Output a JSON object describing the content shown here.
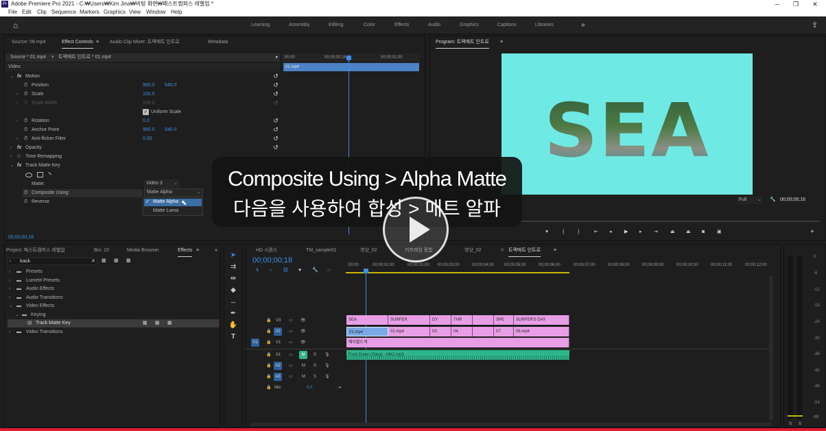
{
  "app": {
    "icon": "Pr",
    "title": "Adobe Premiere Pro 2021 - C:₩Users₩Kim Jina₩바탕 화면₩패스트캠퍼스 레벨업 *"
  },
  "menu": [
    "File",
    "Edit",
    "Clip",
    "Sequence",
    "Markers",
    "Graphics",
    "View",
    "Window",
    "Help"
  ],
  "workspaces": [
    "Learning",
    "Assembly",
    "Editing",
    "Color",
    "Effects",
    "Audio",
    "Graphics",
    "Captions",
    "Libraries"
  ],
  "source_tabs": {
    "source": "Source: 08.mp4",
    "effect_controls": "Effect Controls",
    "mixer": "Audio Clip Mixer: 트랙매트 인트로",
    "metadata": "Metadata"
  },
  "ec": {
    "source": "Source * 01.mp4",
    "seq": "트랙매트 인트로 * 01.mp4",
    "video": "Video",
    "motion": "Motion",
    "position": "Position",
    "position_x": "960.0",
    "position_y": "540.0",
    "scale": "Scale",
    "scale_val": "100.0",
    "scale_width": "Scale Width",
    "scale_width_val": "100.0",
    "uniform": "Uniform Scale",
    "rotation": "Rotation",
    "rotation_val": "0.0",
    "anchor": "Anchor Point",
    "anchor_x": "960.0",
    "anchor_y": "540.0",
    "antiflicker": "Anti-flicker Filter",
    "antiflicker_val": "0.00",
    "opacity": "Opacity",
    "time_remap": "Time Remapping",
    "track_matte": "Track Matte Key",
    "matte": "Matte:",
    "matte_val": "Video 3",
    "composite": "Composite Using:",
    "composite_val": "Matte Alpha",
    "reverse": "Reverse",
    "opt1": "Matte Alpha",
    "opt2": "Matte Luma",
    "timecode": "00;00;00;18",
    "ruler": [
      ";00;00",
      "00;00;00;16",
      "00;00;01;00"
    ],
    "clip": "01.mp4"
  },
  "program": {
    "title": "Program: 트랙매트 인트로",
    "word": "SEA",
    "fit": "Full",
    "timecode": "00;00;06;16"
  },
  "project": {
    "tabs": [
      "Project: 패스트캠퍼스 레벨업",
      "Bin: 10",
      "Media Browser",
      "Effects"
    ],
    "search": "track",
    "items": [
      "Presets",
      "Lumetri Presets",
      "Audio Effects",
      "Audio Transitions",
      "Video Effects",
      "Keying",
      "Track Matte Key",
      "Video Transitions"
    ]
  },
  "timeline": {
    "tabs": [
      "HD 시퀀스",
      "TM_sample01",
      "영상_02",
      "키프레임 종합",
      "영상_02",
      "트랙매트 인트로"
    ],
    "timecode": "00;00;00;18",
    "ruler": [
      ";00;00",
      "00;00;01;00",
      "00;00;02;00",
      "00;00;03;00",
      "00;00;04;00",
      "00;00;05;00",
      "00;00;06;00",
      "00;00;07;00",
      "00;00;08;00",
      "00;00;09;00",
      "00;00;10;00",
      "00;00;11;00",
      "00;00;12;00"
    ],
    "tracks": [
      "V3",
      "V2",
      "V1",
      "A1",
      "A2",
      "A3"
    ],
    "source_patch": [
      "V1",
      "A1"
    ],
    "mix": "Mix",
    "mix_val": "0.0",
    "v3": [
      "SEA",
      "SURFER",
      "DY",
      "THR",
      "",
      "SPE",
      "SURFER'S DAY"
    ],
    "v2": [
      "01.mp4",
      "02.mp4",
      "03.",
      "04.",
      "",
      "07.",
      "08.mp4"
    ],
    "v1": "메이팔드색",
    "a1": "Funk Down (Sting) - MK2.mp3"
  },
  "meter": [
    "0",
    "-6",
    "-12",
    "-18",
    "-24",
    "-30",
    "-36",
    "-42",
    "-48",
    "-54",
    "dB"
  ],
  "overlay": {
    "line1": "Composite Using > Alpha Matte",
    "line2": "다음을 사용하여 합성 > 매트 알파"
  },
  "colors": {
    "accent": "#3a8fe8",
    "program_bg": "#6ee9e3",
    "title_clip": "#e79ee6",
    "audio_clip": "#2fb58a",
    "progress": "#e01c3a"
  }
}
